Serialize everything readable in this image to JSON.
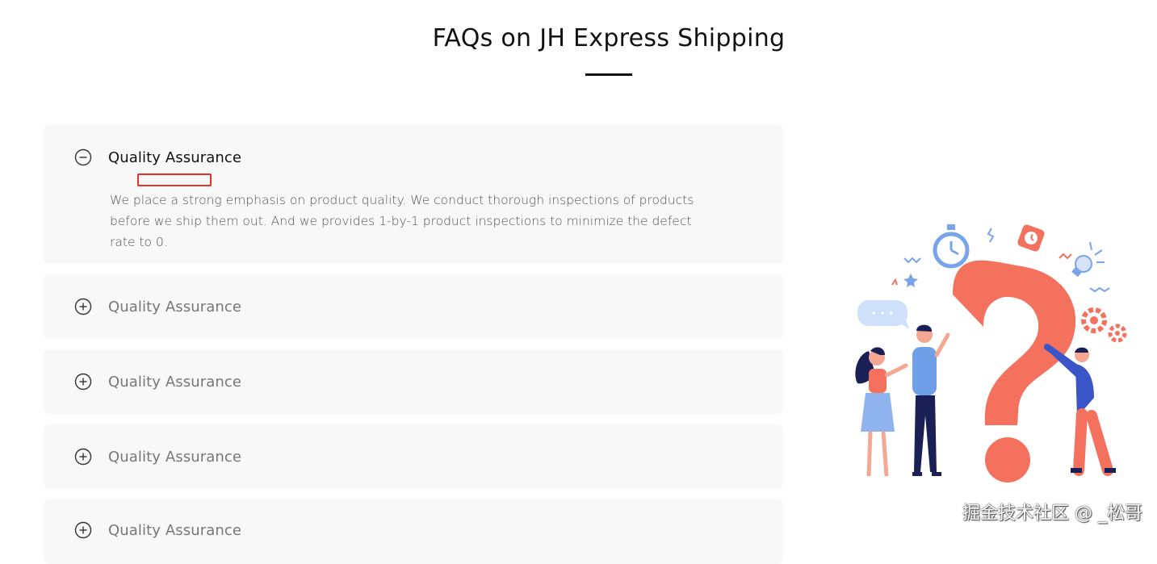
{
  "page": {
    "title": "FAQs on JH Express Shipping"
  },
  "faq": {
    "items": [
      {
        "question": "Quality Assurance",
        "answer": "We place a strong emphasis on product quality. We conduct thorough inspections of products before we ship them out. And we provides 1-by-1 product inspections to minimize the defect rate to 0.",
        "expanded": true,
        "icon": "minus-circle-icon"
      },
      {
        "question": "Quality Assurance",
        "expanded": false,
        "icon": "plus-circle-icon"
      },
      {
        "question": "Quality Assurance",
        "expanded": false,
        "icon": "plus-circle-icon"
      },
      {
        "question": "Quality Assurance",
        "expanded": false,
        "icon": "plus-circle-icon"
      },
      {
        "question": "Quality Assurance",
        "expanded": false,
        "icon": "plus-circle-icon"
      }
    ]
  },
  "illustration": {
    "icon": "question-mark-people-illustration",
    "chat_bubble_text": "• • •"
  },
  "watermark": {
    "text": "掘金技术社区 @ _松哥"
  },
  "colors": {
    "accent": "#f4715e",
    "blue": "#6f9fe8",
    "navy": "#1a2056",
    "highlight_border": "#e0342b",
    "card_bg": "#f8f8f8"
  }
}
